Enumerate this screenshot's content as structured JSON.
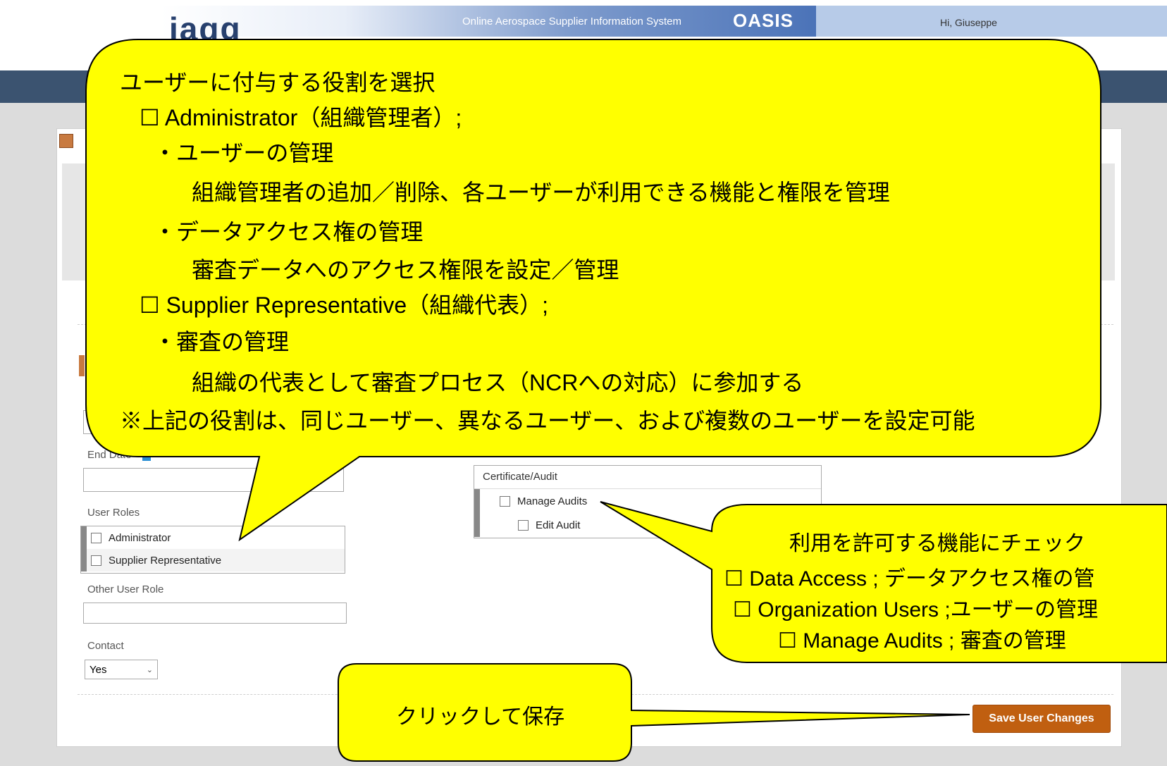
{
  "header": {
    "logo_text": "iaqg",
    "system_name": "Online Aerospace Supplier Information System",
    "system_abbr": "OASIS",
    "greeting": "Hi, Giuseppe"
  },
  "form": {
    "end_date_label": "End Date",
    "user_roles_label": "User Roles",
    "roles": [
      "Administrator",
      "Supplier Representative"
    ],
    "other_role_label": "Other User Role",
    "other_role_value": "",
    "contact_label": "Contact",
    "contact_value": "Yes",
    "save_label": "Save User Changes"
  },
  "permissions": {
    "group": "Certificate/Audit",
    "items": [
      "Manage Audits",
      "Edit Audit"
    ]
  },
  "callouts": {
    "roles": {
      "lines": [
        "ユーザーに付与する役割を選択",
        "☐ Administrator（組織管理者）;",
        "・ユーザーの管理",
        "組織管理者の追加／削除、各ユーザーが利用できる機能と権限を管理",
        "・データアクセス権の管理",
        "審査データへのアクセス権限を設定／管理",
        "☐ Supplier Representative（組織代表）;",
        "・審査の管理",
        "組織の代表として審査プロセス（NCRへの対応）に参加する",
        "※上記の役割は、同じユーザー、異なるユーザー、および複数のユーザーを設定可能"
      ]
    },
    "functions": {
      "lines": [
        "利用を許可する機能にチェック",
        "☐ Data Access ; データアクセス権の管",
        "☐ Organization Users ;ユーザーの管理",
        "☐ Manage Audits ; 審査の管理"
      ]
    },
    "save": {
      "text": "クリックして保存"
    }
  },
  "colors": {
    "callout_fill": "#ffff00",
    "navbar": "#3b5370",
    "save_button": "#c05f10"
  }
}
